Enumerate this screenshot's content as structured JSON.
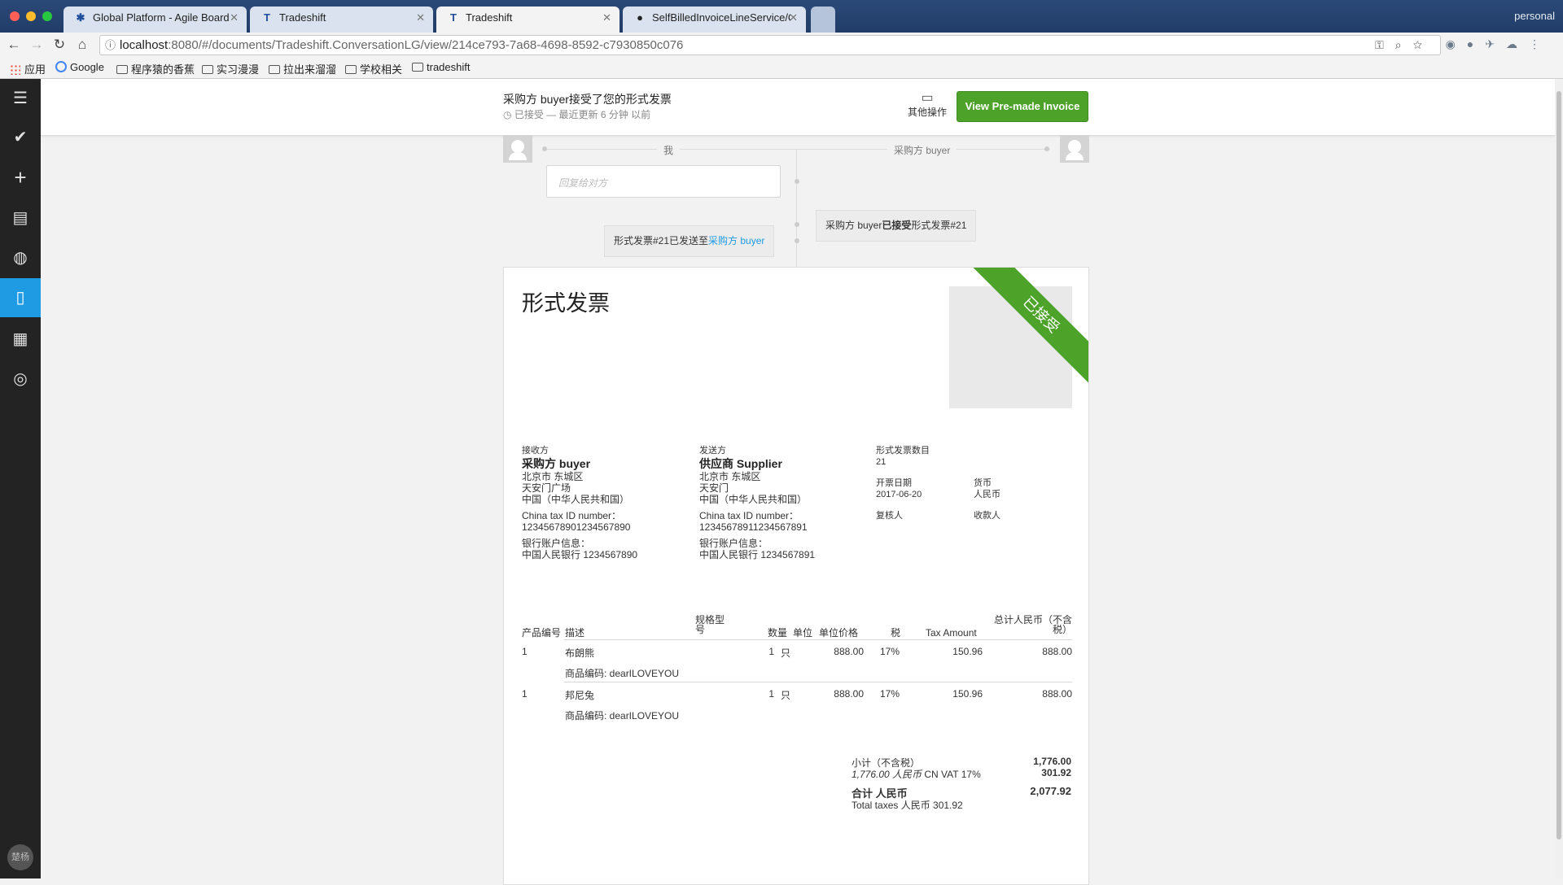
{
  "browser": {
    "tabs": [
      {
        "title": "Global Platform - Agile Board",
        "active": false
      },
      {
        "title": "Tradeshift",
        "active": false
      },
      {
        "title": "Tradeshift",
        "active": true
      },
      {
        "title": "SelfBilledInvoiceLineService/C",
        "active": false
      }
    ],
    "profile": "personal",
    "url_host": "localhost",
    "url_rest": ":8080/#/documents/Tradeshift.ConversationLG/view/214ce793-7a68-4698-8592-c7930850c076"
  },
  "bookmarks": [
    {
      "label": "应用",
      "icon": "apps-icon"
    },
    {
      "label": "Google",
      "icon": "google-icon"
    },
    {
      "label": "程序猿的香蕉",
      "icon": "folder-icon"
    },
    {
      "label": "实习漫漫",
      "icon": "folder-icon"
    },
    {
      "label": "拉出来溜溜",
      "icon": "folder-icon"
    },
    {
      "label": "学校相关",
      "icon": "folder-icon"
    },
    {
      "label": "tradeshift",
      "icon": "folder-icon"
    }
  ],
  "sidebar": {
    "items": [
      {
        "icon": "menu-icon",
        "active": false
      },
      {
        "icon": "check-icon",
        "active": false
      },
      {
        "icon": "plus-icon",
        "active": false
      },
      {
        "icon": "ledger-icon",
        "active": false
      },
      {
        "icon": "globe-icon",
        "active": false
      },
      {
        "icon": "document-icon",
        "active": true
      },
      {
        "icon": "apps-grid-icon",
        "active": false
      },
      {
        "icon": "lifebuoy-icon",
        "active": false
      }
    ],
    "user_avatar": "楚杨"
  },
  "header": {
    "title": "采购方 buyer接受了您的形式发票",
    "status": "已接受 — 最近更新 6 分钟 以前",
    "other_actions": "其他操作",
    "view_button": "View Pre-made Invoice"
  },
  "timeline": {
    "me_label": "我",
    "buyer_label": "采购方 buyer",
    "reply_placeholder": "回复给对方",
    "event_accepted_prefix": "采购方 buyer",
    "event_accepted_bold": "已接受",
    "event_accepted_suffix": "形式发票#21",
    "event_sent_prefix": "形式发票#21已发送至",
    "event_sent_link": "采购方 buyer"
  },
  "document": {
    "heading": "形式发票",
    "ribbon": "已接受",
    "recipient": {
      "label": "接收方",
      "name": "采购方 buyer",
      "lines": [
        "北京市 东城区",
        "天安门广场",
        "中国（中华人民共和国）"
      ],
      "tax_label": "China tax ID number：",
      "tax_id": "12345678901234567890",
      "bank_label": "银行账户信息：",
      "bank": "中国人民银行 1234567890"
    },
    "sender": {
      "label": "发送方",
      "name": "供应商 Supplier",
      "lines": [
        "北京市 东城区",
        "天安门",
        "中国（中华人民共和国）"
      ],
      "tax_label": "China tax ID number：",
      "tax_id": "12345678911234567891",
      "bank_label": "银行账户信息：",
      "bank": "中国人民银行 1234567891"
    },
    "meta": {
      "number_label": "形式发票数目",
      "number": "21",
      "date_label": "开票日期",
      "date": "2017-06-20",
      "currency_label": "货币",
      "currency": "人民币",
      "reviewer_label": "复核人",
      "payee_label": "收款人"
    },
    "columns": {
      "code": "产品编号",
      "desc": "描述",
      "model_a": "规格型",
      "model_b": "号",
      "qty": "数量",
      "unit": "单位",
      "price": "单位价格",
      "tax": "税",
      "tax_amount": "Tax Amount",
      "total_a": "总计人民币（不含",
      "total_b": "税）"
    },
    "rows": [
      {
        "code": "1",
        "desc": "布朗熊",
        "sub": "商品编码: dearILOVEYOU",
        "qty": "1",
        "unit": "只",
        "price": "888.00",
        "tax": "17%",
        "tax_amount": "150.96",
        "total": "888.00"
      },
      {
        "code": "1",
        "desc": "邦尼兔",
        "sub": "商品编码: dearILOVEYOU",
        "qty": "1",
        "unit": "只",
        "price": "888.00",
        "tax": "17%",
        "tax_amount": "150.96",
        "total": "888.00"
      }
    ],
    "totals": {
      "subtotal_label": "小计（不含税）",
      "subtotal": "1,776.00",
      "vat_label_italic": "1,776.00 人民币",
      "vat_label_rest": " CN VAT 17%",
      "vat": "301.92",
      "grand_label": "合计 人民币",
      "grand": "2,077.92",
      "total_taxes": "Total taxes 人民币 301.92"
    }
  },
  "colors": {
    "accent_blue": "#1f9be3",
    "accept_green": "#4da32a",
    "sidebar_bg": "#232323"
  }
}
